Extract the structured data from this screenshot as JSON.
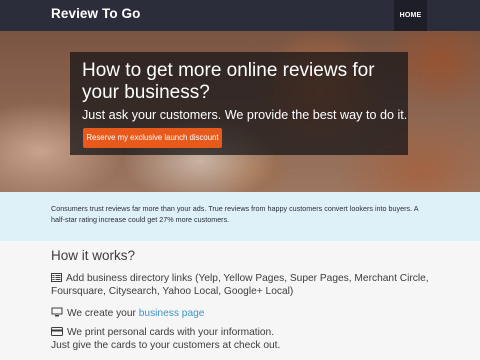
{
  "navbar": {
    "brand": "Review To Go",
    "items": [
      {
        "label": "HOME",
        "active": true
      }
    ]
  },
  "hero": {
    "title": "How to get more online reviews for your business?",
    "subtitle": "Just ask your customers. We provide the best way to do it.",
    "cta_label": "Reserve my exclusive launch discount"
  },
  "info": {
    "text": "Consumers trust reviews far more than your ads. True reviews from happy customers convert lookers into buyers. A half-star rating increase could get 27% more customers."
  },
  "how_it_works": {
    "title": "How it works?",
    "steps": [
      {
        "icon": "list-icon",
        "text": "Add business directory links (Yelp, Yellow Pages, Super Pages, Merchant Circle, Foursquare, Citysearch, Yahoo Local, Google+ Local)"
      },
      {
        "icon": "monitor-icon",
        "text_before": "We create your",
        "link": "business page"
      },
      {
        "icon": "credit-card-icon",
        "line1": "We print personal cards with your information.",
        "line2": "Just give the cards to your customers at check out."
      }
    ]
  },
  "colors": {
    "navbar": "#2b2d3a",
    "cta": "#e8591c",
    "info_band": "#dff1f8",
    "link": "#3b97c4"
  }
}
